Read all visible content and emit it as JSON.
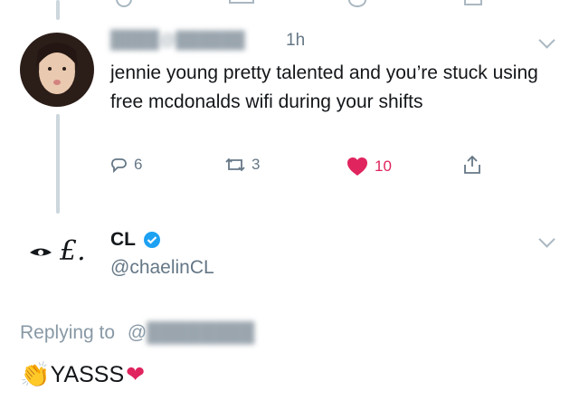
{
  "tweet": {
    "time": "1h",
    "text": "jennie young pretty talented and you’re stuck using free mcdonalds wifi during your shifts",
    "actions": {
      "replies": "6",
      "retweets": "3",
      "likes": "10"
    }
  },
  "profile": {
    "name": "CL",
    "handle": "@chaelinCL",
    "logo_text": "£."
  },
  "reply": {
    "replying_label": "Replying to",
    "at_prefix": "@",
    "text": "YASSS",
    "leading_emoji": "👏",
    "trailing_emoji": "❤"
  },
  "colors": {
    "like_red": "#e0245e",
    "verified_blue": "#1da1f2",
    "meta_gray": "#8899a6"
  }
}
